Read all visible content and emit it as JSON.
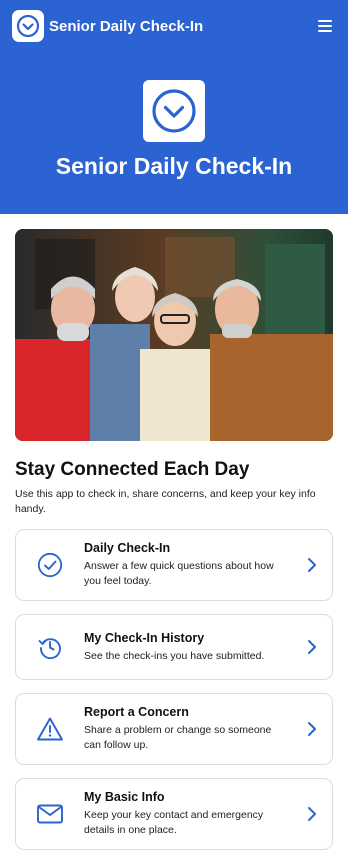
{
  "header": {
    "app_name": "Senior Daily Check-In",
    "menu_icon": "hamburger-menu-icon",
    "logo_icon": "check-circle-icon"
  },
  "hero": {
    "title": "Senior Daily Check-In",
    "logo_icon": "check-circle-icon",
    "background_color": "#2b63d2"
  },
  "photo": {
    "subject": "group-of-four-smiling-seniors-photo"
  },
  "intro": {
    "title": "Stay Connected Each Day",
    "text": "Use this app to check in, share concerns, and keep your key info handy."
  },
  "cards": [
    {
      "title": "Daily Check-In",
      "description": "Answer a few quick questions about how you feel today.",
      "icon": "check-circle-icon"
    },
    {
      "title": "My Check-In History",
      "description": "See the check-ins you have submitted.",
      "icon": "history-icon"
    },
    {
      "title": "Report a Concern",
      "description": "Share a problem or change so someone can follow up.",
      "icon": "warning-triangle-icon"
    },
    {
      "title": "My Basic Info",
      "description": "Keep your key contact and emergency details in one place.",
      "icon": "envelope-icon"
    }
  ],
  "colors": {
    "accent": "#2b63d2",
    "card_border": "#d9dde3"
  }
}
